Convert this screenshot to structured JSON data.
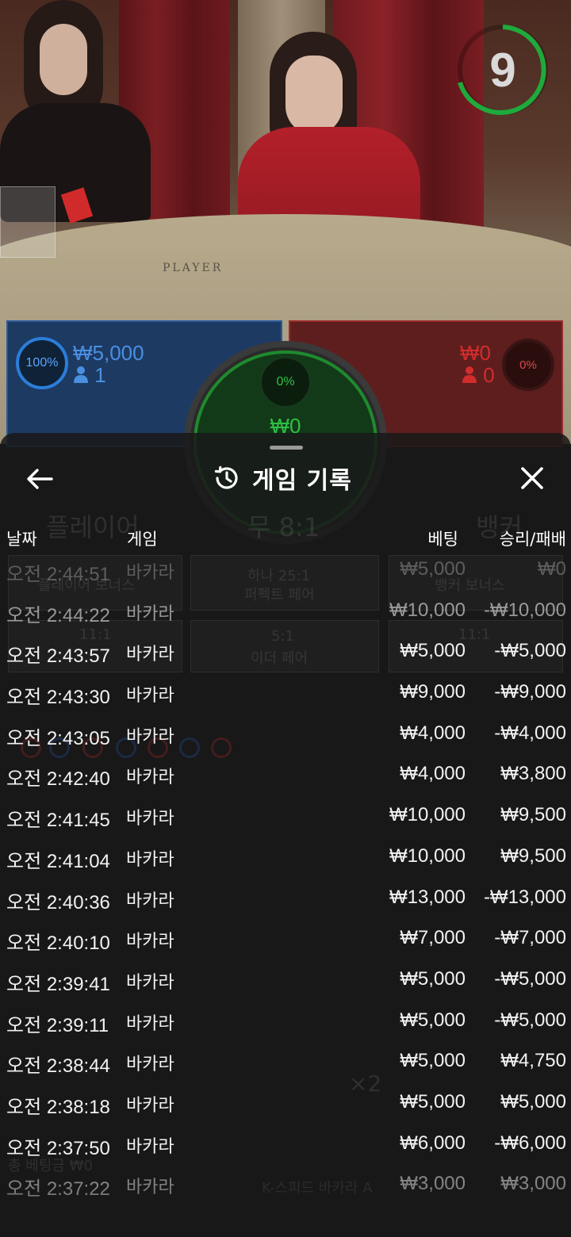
{
  "game": {
    "timer": "9",
    "table_label": "PLAYER",
    "player": {
      "percent": "100%",
      "amount": "₩5,000",
      "count": "1"
    },
    "banker": {
      "percent": "0%",
      "amount": "₩0",
      "count": "0"
    },
    "tie": {
      "percent": "0%",
      "amount": "₩0"
    }
  },
  "history": {
    "title": "게임 기록",
    "columns": {
      "date": "날짜",
      "game": "게임",
      "bet": "베팅",
      "result": "승리/패배"
    },
    "rows": [
      {
        "date": "오전 2:44:51",
        "game": "바카라",
        "bet": "₩5,000",
        "result": "₩0"
      },
      {
        "date": "오전 2:44:22",
        "game": "바카라",
        "bet": "₩10,000",
        "result": "-₩10,000"
      },
      {
        "date": "오전 2:43:57",
        "game": "바카라",
        "bet": "₩5,000",
        "result": "-₩5,000"
      },
      {
        "date": "오전 2:43:30",
        "game": "바카라",
        "bet": "₩9,000",
        "result": "-₩9,000"
      },
      {
        "date": "오전 2:43:05",
        "game": "바카라",
        "bet": "₩4,000",
        "result": "-₩4,000"
      },
      {
        "date": "오전 2:42:40",
        "game": "바카라",
        "bet": "₩4,000",
        "result": "₩3,800"
      },
      {
        "date": "오전 2:41:45",
        "game": "바카라",
        "bet": "₩10,000",
        "result": "₩9,500"
      },
      {
        "date": "오전 2:41:04",
        "game": "바카라",
        "bet": "₩10,000",
        "result": "₩9,500"
      },
      {
        "date": "오전 2:40:36",
        "game": "바카라",
        "bet": "₩13,000",
        "result": "-₩13,000"
      },
      {
        "date": "오전 2:40:10",
        "game": "바카라",
        "bet": "₩7,000",
        "result": "-₩7,000"
      },
      {
        "date": "오전 2:39:41",
        "game": "바카라",
        "bet": "₩5,000",
        "result": "-₩5,000"
      },
      {
        "date": "오전 2:39:11",
        "game": "바카라",
        "bet": "₩5,000",
        "result": "-₩5,000"
      },
      {
        "date": "오전 2:38:44",
        "game": "바카라",
        "bet": "₩5,000",
        "result": "₩4,750"
      },
      {
        "date": "오전 2:38:18",
        "game": "바카라",
        "bet": "₩5,000",
        "result": "₩5,000"
      },
      {
        "date": "오전 2:37:50",
        "game": "바카라",
        "bet": "₩6,000",
        "result": "-₩6,000"
      },
      {
        "date": "오전 2:37:22",
        "game": "바카라",
        "bet": "₩3,000",
        "result": "₩3,000"
      }
    ]
  },
  "background_ui": {
    "player_label": "플레이어",
    "tie_label": "무 8:1",
    "banker_label": "뱅커",
    "player_bonus": "플레이어 보너스",
    "perfect_pair_odds": "하나 25:1",
    "perfect_pair": "퍼펙트 페어",
    "banker_bonus": "뱅커 보너스",
    "player_pair_odds": "11:1",
    "either_pair_odds": "5:1",
    "either_pair": "이더 페어",
    "banker_pair_odds": "11:1",
    "total_bet": "총 베팅금 ₩0",
    "table_name": "K-스피드 바카라 A",
    "multiplier": "×2"
  },
  "colors": {
    "player_blue": "#2b7ed8",
    "banker_red": "#d22c2c",
    "tie_green": "#2fbf46",
    "timer_green": "#1faa3c"
  },
  "icons": {
    "back": "arrow-left-icon",
    "history": "history-clock-icon",
    "close": "close-icon",
    "user": "user-icon"
  }
}
